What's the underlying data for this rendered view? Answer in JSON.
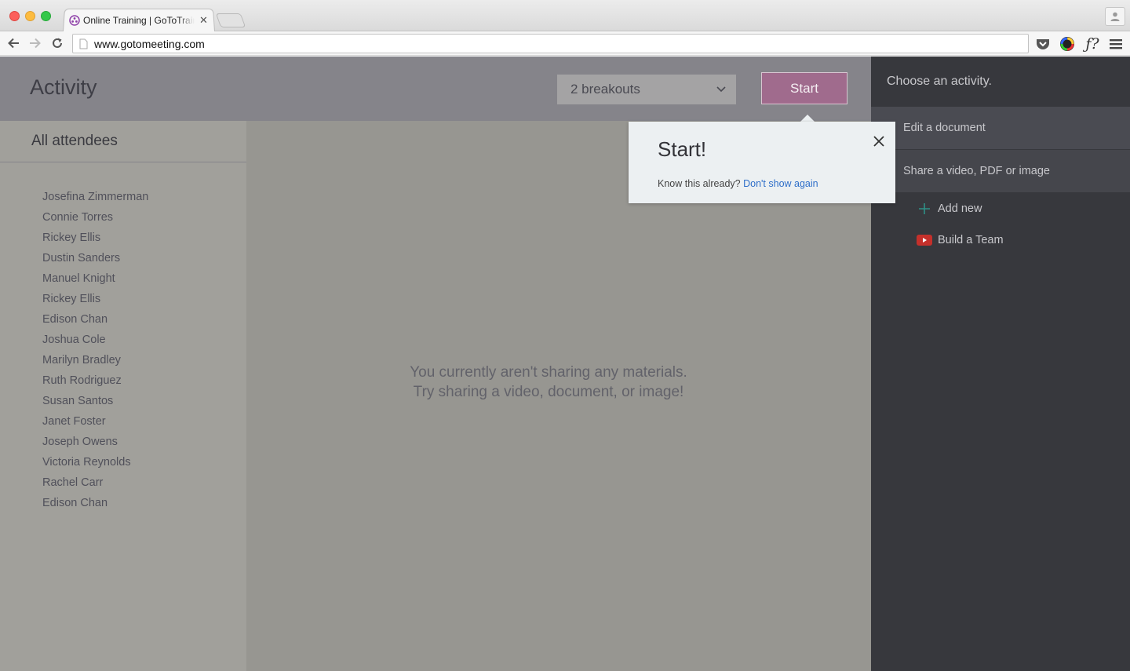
{
  "browser": {
    "tab_title": "Online Training | GoToTraining",
    "url": "www.gotomeeting.com"
  },
  "header": {
    "title": "Activity",
    "breakout_select": "2 breakouts",
    "start_label": "Start"
  },
  "attendees": {
    "heading": "All attendees",
    "names": [
      "Josefina Zimmerman",
      "Connie Torres",
      "Rickey Ellis",
      "Dustin Sanders",
      "Manuel Knight",
      "Rickey Ellis",
      "Edison Chan",
      "Joshua Cole",
      "Marilyn Bradley",
      "Ruth Rodriguez",
      "Susan Santos",
      "Janet Foster",
      "Joseph Owens",
      "Victoria Reynolds",
      "Rachel Carr",
      "Edison Chan"
    ]
  },
  "main": {
    "empty_line1": "You currently aren't sharing any materials.",
    "empty_line2": "Try sharing a video, document, or image!"
  },
  "activities": {
    "heading": "Choose an activity.",
    "items": [
      {
        "label": "Edit a document"
      },
      {
        "label": "Share a video, PDF or image"
      }
    ],
    "sub_items": [
      {
        "label": "Add new",
        "icon": "plus-icon"
      },
      {
        "label": "Build a Team",
        "icon": "youtube-icon"
      }
    ]
  },
  "popover": {
    "title": "Start!",
    "text": "Know this already?",
    "link": "Don't show again"
  },
  "colors": {
    "start_button": "#a06b8d",
    "link": "#2f6fc9",
    "sidebar_dark": "#37383d"
  }
}
